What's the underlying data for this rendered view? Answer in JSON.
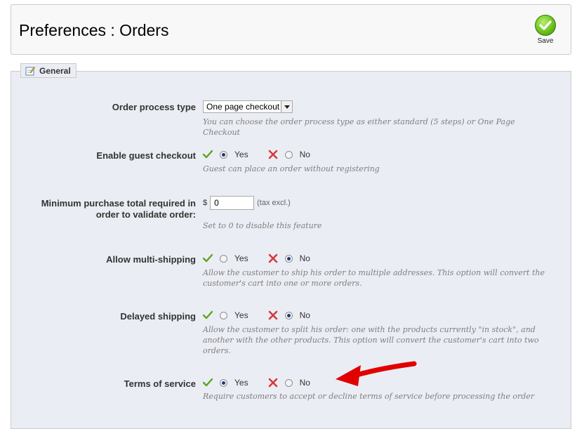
{
  "header": {
    "title": "Preferences : Orders",
    "save_label": "Save"
  },
  "section": {
    "legend": "General"
  },
  "fields": {
    "order_process": {
      "label": "Order process type",
      "selected": "One page checkout",
      "hint": "You can choose the order process type as either standard (5 steps) or One Page Checkout"
    },
    "guest_checkout": {
      "label": "Enable guest checkout",
      "yes": "Yes",
      "no": "No",
      "value": "Yes",
      "hint": "Guest can place an order without registering"
    },
    "min_purchase": {
      "label": "Minimum purchase total required in order to validate order:",
      "currency": "$",
      "value": "0",
      "unit": "(tax excl.)",
      "hint": "Set to 0 to disable this feature"
    },
    "multi_shipping": {
      "label": "Allow multi-shipping",
      "yes": "Yes",
      "no": "No",
      "value": "No",
      "hint": "Allow the customer to ship his order to multiple addresses. This option will convert the customer's cart into one or more orders."
    },
    "delayed_shipping": {
      "label": "Delayed shipping",
      "yes": "Yes",
      "no": "No",
      "value": "No",
      "hint": "Allow the customer to split his order: one with the products currently \"in stock\", and another with the other products. This option will convert the customer's cart into two orders."
    },
    "terms_of_service": {
      "label": "Terms of service",
      "yes": "Yes",
      "no": "No",
      "value": "Yes",
      "hint": "Require customers to accept or decline terms of service before processing the order"
    }
  },
  "colors": {
    "check": "#5aa51f",
    "cross": "#d63a3a",
    "panel_bg": "#ebedf4",
    "annotation_arrow": "#e00000"
  }
}
